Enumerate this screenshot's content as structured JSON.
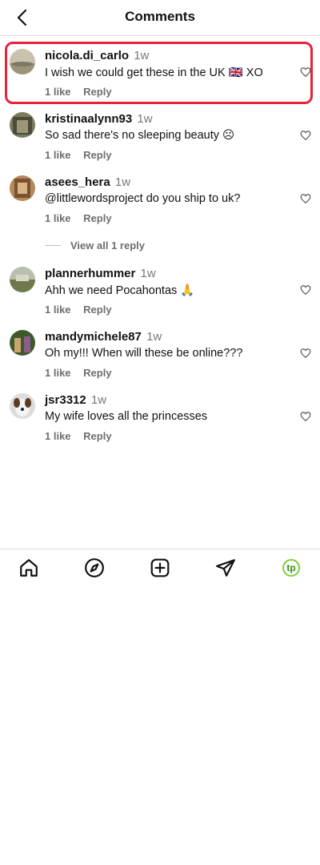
{
  "header": {
    "title": "Comments"
  },
  "comments": [
    {
      "username": "nicola.di_carlo",
      "time": "1w",
      "text": "I wish we could get these in the UK 🇬🇧 XO",
      "likes": "1 like",
      "reply": "Reply",
      "avatar_color": "#b8ad94"
    },
    {
      "username": "kristinaalynn93",
      "time": "1w",
      "text": "So sad there's no sleeping beauty ☹",
      "likes": "1 like",
      "reply": "Reply",
      "avatar_color": "#6b6a4e"
    },
    {
      "username": "asees_hera",
      "time": "1w",
      "text": "@littlewordsproject do you ship to uk?",
      "likes": "1 like",
      "reply": "Reply",
      "avatar_color": "#a37a4a"
    },
    {
      "username": "plannerhummer",
      "time": "1w",
      "text": "Ahh we need Pocahontas 🙏",
      "likes": "1 like",
      "reply": "Reply",
      "avatar_color": "#8c9078"
    },
    {
      "username": "mandymichele87",
      "time": "1w",
      "text": "Oh my!!! When will these be online???",
      "likes": "1 like",
      "reply": "Reply",
      "avatar_color": "#4f6a3a"
    },
    {
      "username": "jsr3312",
      "time": "1w",
      "text": "My wife loves all the princesses",
      "likes": "1 like",
      "reply": "Reply",
      "avatar_color": "#d9d9d9"
    }
  ],
  "view_replies": "View all 1 reply",
  "tabbar": {
    "icons": [
      "home-icon",
      "explore-icon",
      "new-post-icon",
      "send-icon",
      "profile-icon"
    ],
    "profile_initials": "tp"
  },
  "colors": {
    "highlight": "#e3253a",
    "profile_ring": "#7bd13a"
  }
}
